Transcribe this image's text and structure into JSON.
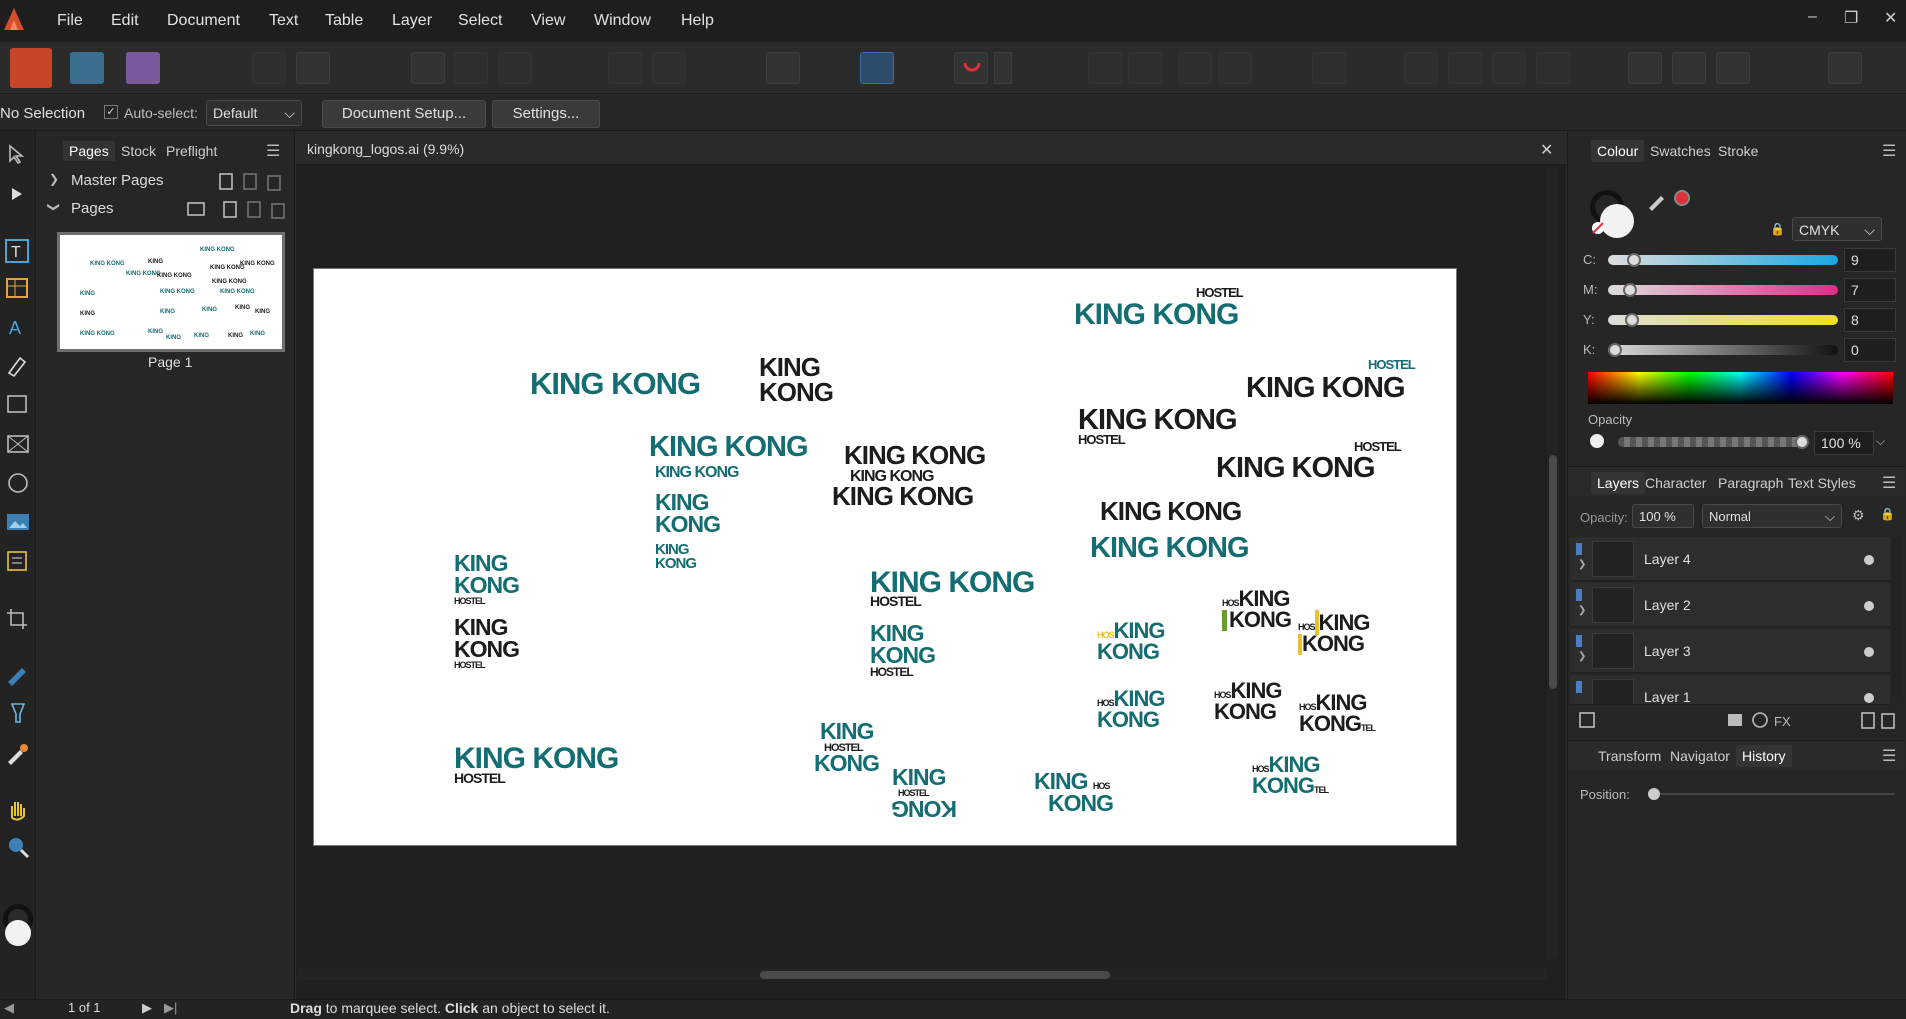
{
  "menu": [
    "File",
    "Edit",
    "Document",
    "Text",
    "Table",
    "Layer",
    "Select",
    "View",
    "Window",
    "Help"
  ],
  "context_bar": {
    "selection": "No Selection",
    "auto_select_label": "Auto-select:",
    "auto_select_value": "Default",
    "document_setup": "Document Setup...",
    "settings": "Settings..."
  },
  "pages_panel": {
    "tabs": [
      "Pages",
      "Stock",
      "Preflight"
    ],
    "master_pages": "Master Pages",
    "pages": "Pages",
    "page_label": "Page 1"
  },
  "document": {
    "tab_title": "kingkong_logos.ai (9.9%)"
  },
  "canvas_logos": {
    "king_kong": "KING KONG",
    "king": "KING",
    "kong": "KONG",
    "hostel": "HOSTEL",
    "hos": "HOS",
    "tel": "TEL",
    "kong_flipped": "KONG"
  },
  "colour_panel": {
    "tabs": [
      "Colour",
      "Swatches",
      "Stroke"
    ],
    "model": "CMYK",
    "channels": [
      {
        "label": "C:",
        "value": "9",
        "level": 0.09
      },
      {
        "label": "M:",
        "value": "7",
        "level": 0.07
      },
      {
        "label": "Y:",
        "value": "8",
        "level": 0.08
      },
      {
        "label": "K:",
        "value": "0",
        "level": 0.0
      }
    ],
    "opacity_label": "Opacity",
    "opacity_value": "100 %"
  },
  "layers_panel": {
    "tabs": [
      "Layers",
      "Character",
      "Paragraph",
      "Text Styles"
    ],
    "opacity_label": "Opacity:",
    "opacity_value": "100 %",
    "blend_mode": "Normal",
    "layers": [
      "Layer 4",
      "Layer 2",
      "Layer 3",
      "Layer 1"
    ]
  },
  "history_panel": {
    "tabs": [
      "Transform",
      "Navigator",
      "History"
    ],
    "position_label": "Position:"
  },
  "status_bar": {
    "page_count": "1 of 1",
    "hint_drag": "Drag",
    "hint_mid": " to marquee select. ",
    "hint_click": "Click",
    "hint_end": " an object to select it."
  },
  "colors": {
    "teal": "#146d73",
    "black": "#1c1c1c",
    "accent_orange": "#e8642c",
    "active_blue": "#3a6ea5"
  }
}
